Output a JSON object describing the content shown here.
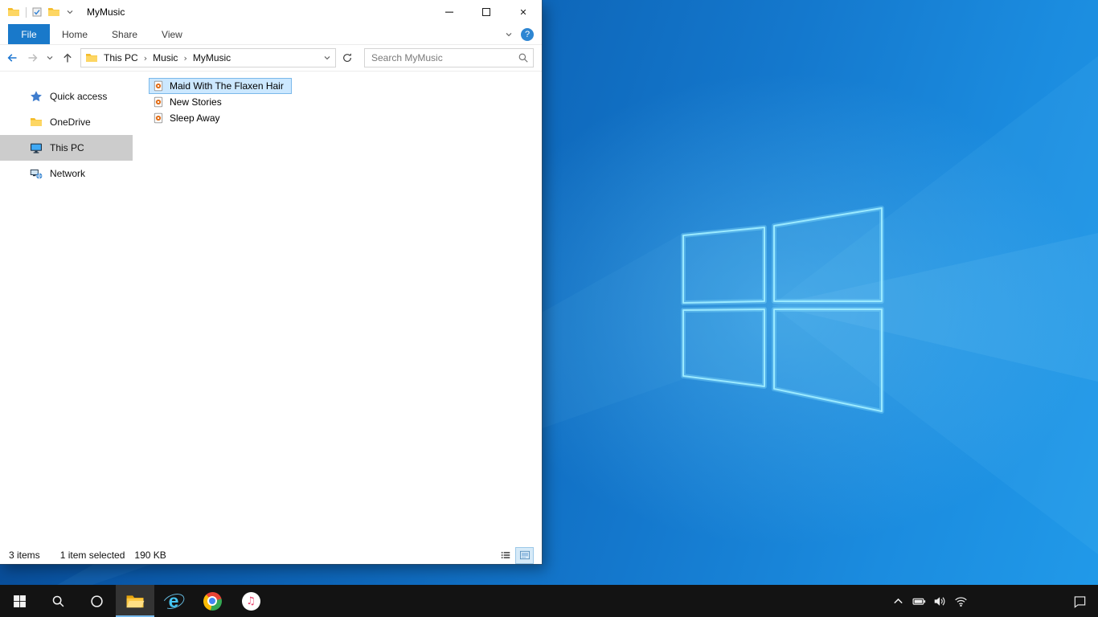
{
  "colors": {
    "accent_blue": "#1979ca",
    "selection_bg": "#cce8ff",
    "selection_border": "#7ab8ea",
    "sidebar_selected_bg": "#cccccc",
    "taskbar_bg": "#131313",
    "desktop_blue": "#1478cd"
  },
  "explorer": {
    "title": "MyMusic",
    "window_controls": {
      "close_glyph": "✕"
    },
    "help_glyph": "?",
    "tabs": [
      {
        "label": "File"
      },
      {
        "label": "Home"
      },
      {
        "label": "Share"
      },
      {
        "label": "View"
      }
    ],
    "address": {
      "crumbs": [
        "This PC",
        "Music",
        "MyMusic"
      ],
      "separator": "›"
    },
    "search": {
      "placeholder": "Search MyMusic"
    },
    "sidebar": [
      {
        "label": "Quick access",
        "icon": "star-icon",
        "selected": false
      },
      {
        "label": "OneDrive",
        "icon": "onedrive-folder-icon",
        "selected": false
      },
      {
        "label": "This PC",
        "icon": "computer-icon",
        "selected": true
      },
      {
        "label": "Network",
        "icon": "network-icon",
        "selected": false
      }
    ],
    "files": [
      {
        "name": "Maid With The Flaxen Hair",
        "icon": "audio-file-icon",
        "selected": true
      },
      {
        "name": "New Stories",
        "icon": "audio-file-icon",
        "selected": false
      },
      {
        "name": "Sleep Away",
        "icon": "audio-file-icon",
        "selected": false
      }
    ],
    "status": {
      "count": "3 items",
      "selected": "1 item selected",
      "size": "190 KB"
    }
  },
  "taskbar": {
    "buttons": [
      "start",
      "search",
      "cortana",
      "file-explorer",
      "internet-explorer",
      "chrome",
      "itunes"
    ],
    "active_button": "file-explorer",
    "tray_icons": [
      "hidden-icons-chevron",
      "battery",
      "volume",
      "wifi"
    ],
    "action_center": "action-center",
    "ie_glyph": "e",
    "itunes_glyph": "♫"
  }
}
